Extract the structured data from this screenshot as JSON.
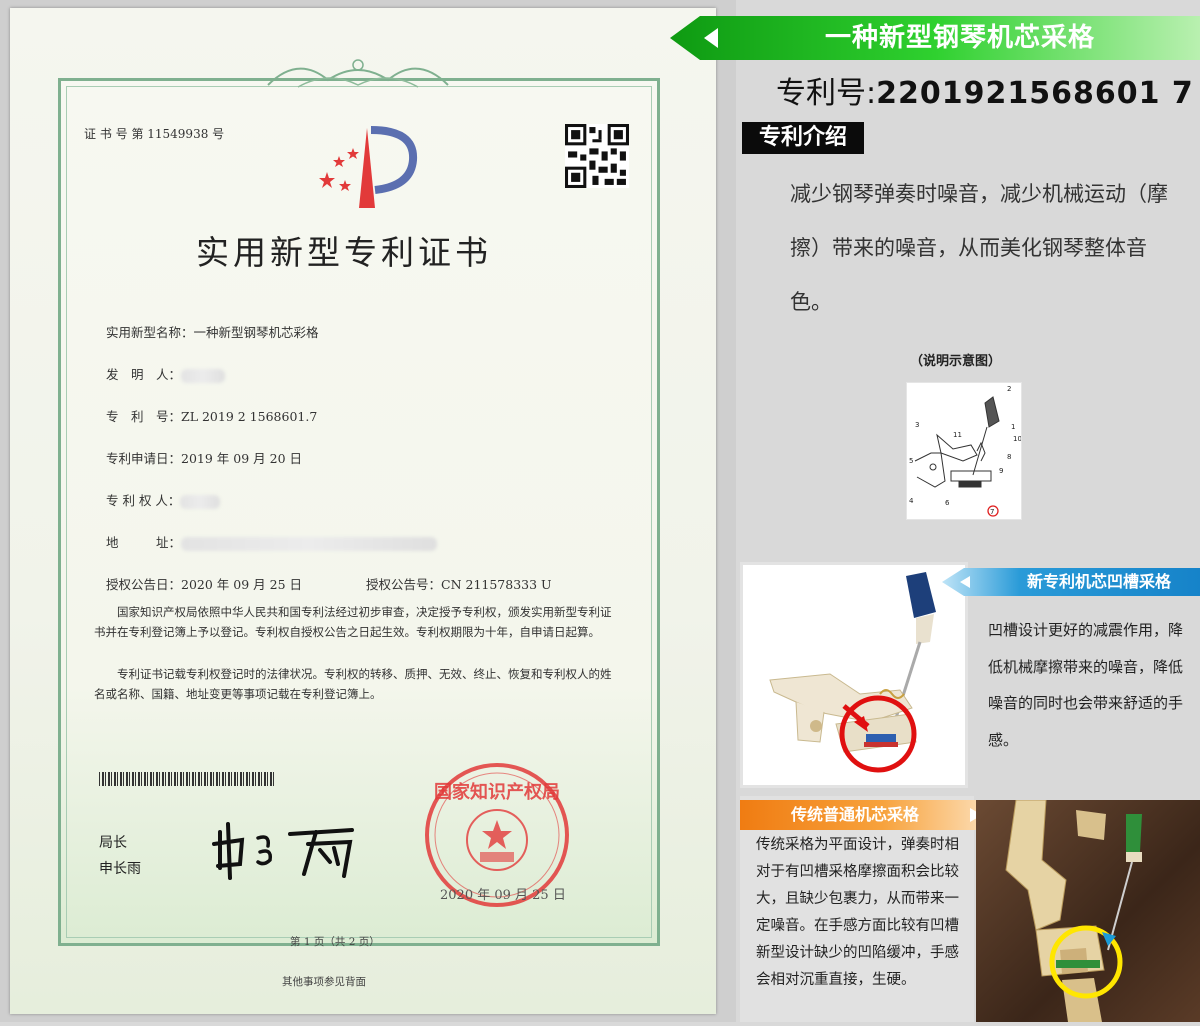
{
  "certificate": {
    "cert_no": "证 书 号 第 11549938 号",
    "title": "实用新型专利证书",
    "fields": [
      {
        "label": "实用新型名称：",
        "value": "一种新型钢琴机芯彩格"
      },
      {
        "label": "发　明　人：",
        "value": ""
      },
      {
        "label": "专　利　号：",
        "value": "ZL 2019 2 1568601.7"
      },
      {
        "label": "专利申请日：",
        "value": "2019 年 09 月 20 日"
      },
      {
        "label": "专 利 权 人：",
        "value": ""
      },
      {
        "label": "地　　　址：",
        "value": ""
      }
    ],
    "grant_date_label": "授权公告日：",
    "grant_date": "2020 年 09 月 25 日",
    "grant_no_label": "授权公告号：",
    "grant_no": "CN 211578333 U",
    "paragraph1": "国家知识产权局依照中华人民共和国专利法经过初步审查，决定授予专利权，颁发实用新型专利证书并在专利登记簿上予以登记。专利权自授权公告之日起生效。专利权期限为十年，自申请日起算。",
    "paragraph2": "专利证书记载专利权登记时的法律状况。专利权的转移、质押、无效、终止、恢复和专利权人的姓名或名称、国籍、地址变更等事项记载在专利登记簿上。",
    "director_title": "局长",
    "director_name": "申长雨",
    "seal_text": "国家知识产权局",
    "seal_date": "2020 年 09 月 25 日",
    "page_no": "第 1 页（共 2 页）",
    "note": "其他事项参见背面"
  },
  "header": {
    "title": "一种新型钢琴机芯采格",
    "patent_label": "专利号:",
    "patent_no": "2201921568601 7"
  },
  "intro": {
    "label": "专利介绍",
    "text": "减少钢琴弹奏时噪音，减少机械运动（摩擦）带来的噪音，从而美化钢琴整体音色。",
    "diagram_caption": "（说明示意图）",
    "diagram_labels": [
      "1",
      "2",
      "3",
      "4",
      "5",
      "6",
      "7",
      "8",
      "9",
      "10",
      "11"
    ]
  },
  "new_design": {
    "title": "新专利机芯凹槽采格",
    "text": "凹槽设计更好的减震作用，降低机械摩擦带来的噪音，降低噪音的同时也会带来舒适的手感。"
  },
  "old_design": {
    "title": "传统普通机芯采格",
    "text": "传统采格为平面设计，弹奏时相对于有凹槽采格摩擦面积会比较大，且缺少包裹力，从而带来一定噪音。在手感方面比较有凹槽新型设计缺少的凹陷缓冲，手感会相对沉重直接，生硬。"
  },
  "colors": {
    "green_banner": "#2fd12f",
    "blue_banner": "#1f95d6",
    "orange_banner": "#f08a1e",
    "seal_red": "#e23a3a",
    "frame_green": "#7fb08f",
    "highlight_yellow": "#ffe600"
  }
}
